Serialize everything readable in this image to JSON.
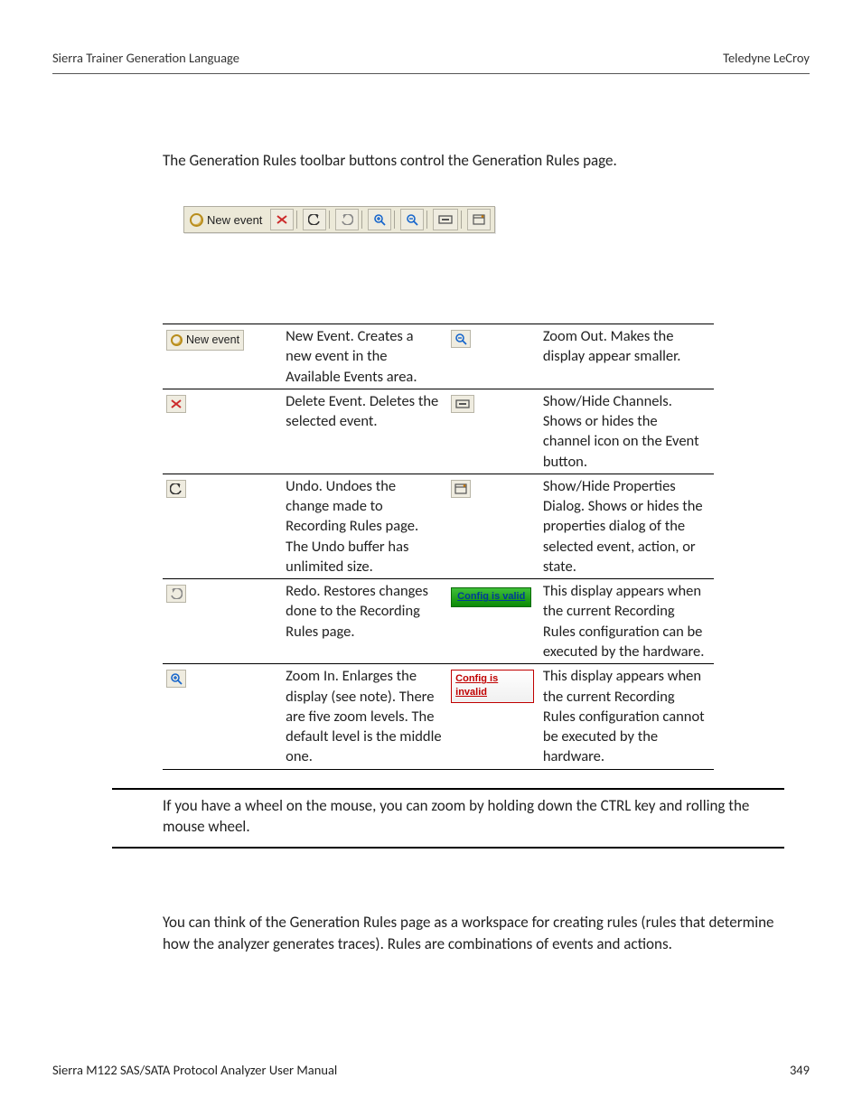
{
  "header": {
    "left": "Sierra Trainer Generation Language",
    "right": "Teledyne LeCroy"
  },
  "intro": "The Generation Rules toolbar buttons control the Generation Rules page.",
  "toolbar": {
    "new_event_label": "New event"
  },
  "table": {
    "rows": {
      "r0": {
        "a_label": "New event",
        "a_desc": "New Event. Creates a new event in the Available Events area.",
        "b_desc": "Zoom Out. Makes the display appear smaller."
      },
      "r1": {
        "a_desc": "Delete Event. Deletes the selected event.",
        "b_desc": "Show/Hide Channels. Shows or hides the channel icon on the Event button."
      },
      "r2": {
        "a_desc": "Undo. Undoes the change made to Recording Rules page. The Undo buffer has unlimited size.",
        "b_desc": "Show/Hide Properties Dialog. Shows or hides the properties dialog of the selected event, action, or state."
      },
      "r3": {
        "a_desc": "Redo. Restores changes done to the Recording Rules page.",
        "b_label": "Config is valid",
        "b_desc": "This display appears when the current Recording Rules configuration can be executed by the hardware."
      },
      "r4": {
        "a_desc": "Zoom In. Enlarges the display (see note). There are five zoom levels. The default level is the middle one.",
        "b_label": "Config is invalid",
        "b_desc": "This display appears when the current Recording Rules configuration cannot be executed by the hardware."
      }
    }
  },
  "note": "If you have a wheel on the mouse, you can zoom by holding down the CTRL key and rolling the mouse wheel.",
  "para2": "You can think of the Generation Rules page as a workspace for creating rules (rules that determine how the analyzer generates traces). Rules are combinations of events and actions.",
  "footer": {
    "left": "Sierra M122 SAS/SATA Protocol Analyzer User Manual",
    "right": "349"
  }
}
